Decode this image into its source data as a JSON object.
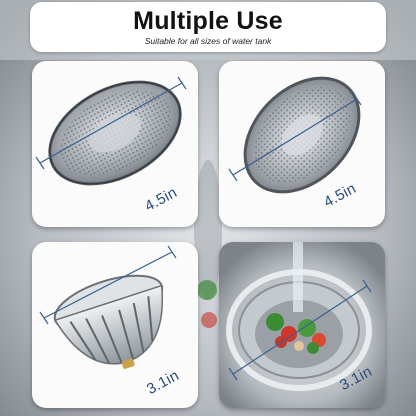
{
  "header": {
    "title": "Multiple Use",
    "subtitle": "Suitable for all sizes of water tank"
  },
  "cards": [
    {
      "size_label": "4.5in",
      "product": "mesh-sink-strainer"
    },
    {
      "size_label": "4.5in",
      "product": "mesh-sink-strainer"
    },
    {
      "size_label": "3.1in",
      "product": "flower-shaped-sink-strainer"
    },
    {
      "size_label": "3.1in",
      "product": "strainer-in-sink-with-vegetables"
    }
  ],
  "colors": {
    "size_label": "#2a4d7a",
    "dimension_line": "#3b5f8f",
    "header_bg": "#ffffff",
    "card_bg": "#fbfbfb"
  }
}
